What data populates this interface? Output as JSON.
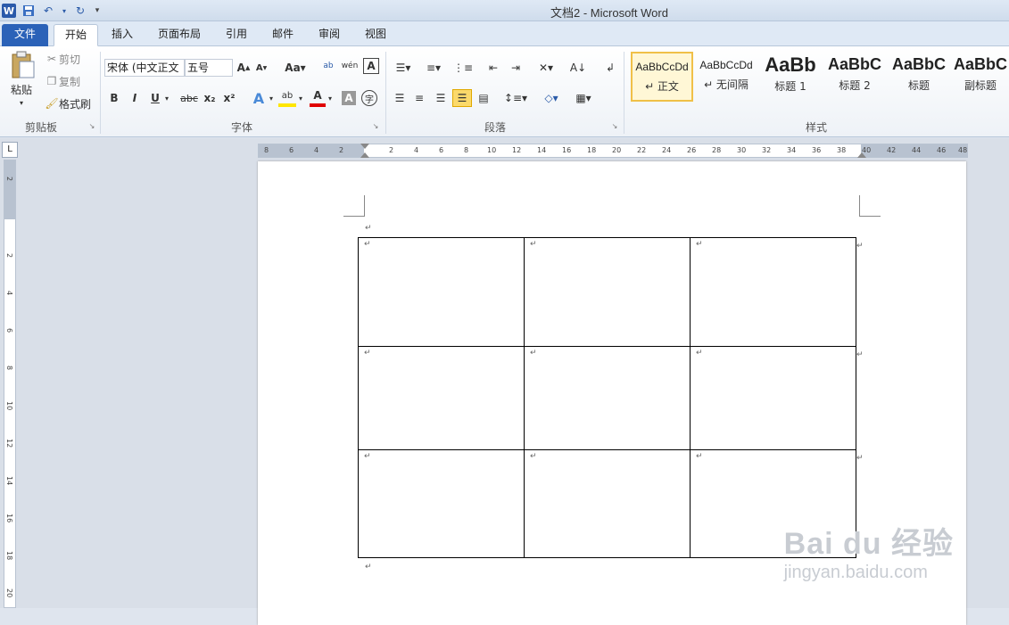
{
  "window": {
    "title": "文档2 - Microsoft Word"
  },
  "qat": {
    "logo": "W"
  },
  "tabs": [
    {
      "label": "文件"
    },
    {
      "label": "开始"
    },
    {
      "label": "插入"
    },
    {
      "label": "页面布局"
    },
    {
      "label": "引用"
    },
    {
      "label": "邮件"
    },
    {
      "label": "审阅"
    },
    {
      "label": "视图"
    }
  ],
  "clipboard": {
    "paste": "粘贴",
    "cut": "剪切",
    "copy": "复制",
    "format_painter": "格式刷",
    "group": "剪贴板"
  },
  "font": {
    "name": "宋体 (中文正文",
    "size": "五号",
    "group": "字体",
    "bold": "B",
    "italic": "I",
    "underline": "U",
    "strike": "abc",
    "subscript": "x₂",
    "superscript": "x²"
  },
  "paragraph": {
    "group": "段落"
  },
  "styles": {
    "group": "样式",
    "items": [
      {
        "sample": "AaBbCcDd",
        "name": "↵ 正文"
      },
      {
        "sample": "AaBbCcDd",
        "name": "↵ 无间隔"
      },
      {
        "sample": "AaBb",
        "name": "标题 1"
      },
      {
        "sample": "AaBbC",
        "name": "标题 2"
      },
      {
        "sample": "AaBbC",
        "name": "标题"
      },
      {
        "sample": "AaBbC",
        "name": "副标题"
      }
    ]
  },
  "ruler": {
    "h_ticks": [
      "8",
      "6",
      "4",
      "2",
      "2",
      "4",
      "6",
      "8",
      "10",
      "12",
      "14",
      "16",
      "18",
      "20",
      "22",
      "24",
      "26",
      "28",
      "30",
      "32",
      "34",
      "36",
      "38",
      "40",
      "42",
      "44",
      "46",
      "48"
    ],
    "v_ticks": [
      "2",
      "2",
      "4",
      "6",
      "8",
      "10",
      "12",
      "14",
      "16",
      "18",
      "20"
    ],
    "corner": "L"
  },
  "document": {
    "paragraph_mark": "↵"
  },
  "watermark": {
    "brand": "Bai du 经验",
    "url": "jingyan.baidu.com"
  }
}
